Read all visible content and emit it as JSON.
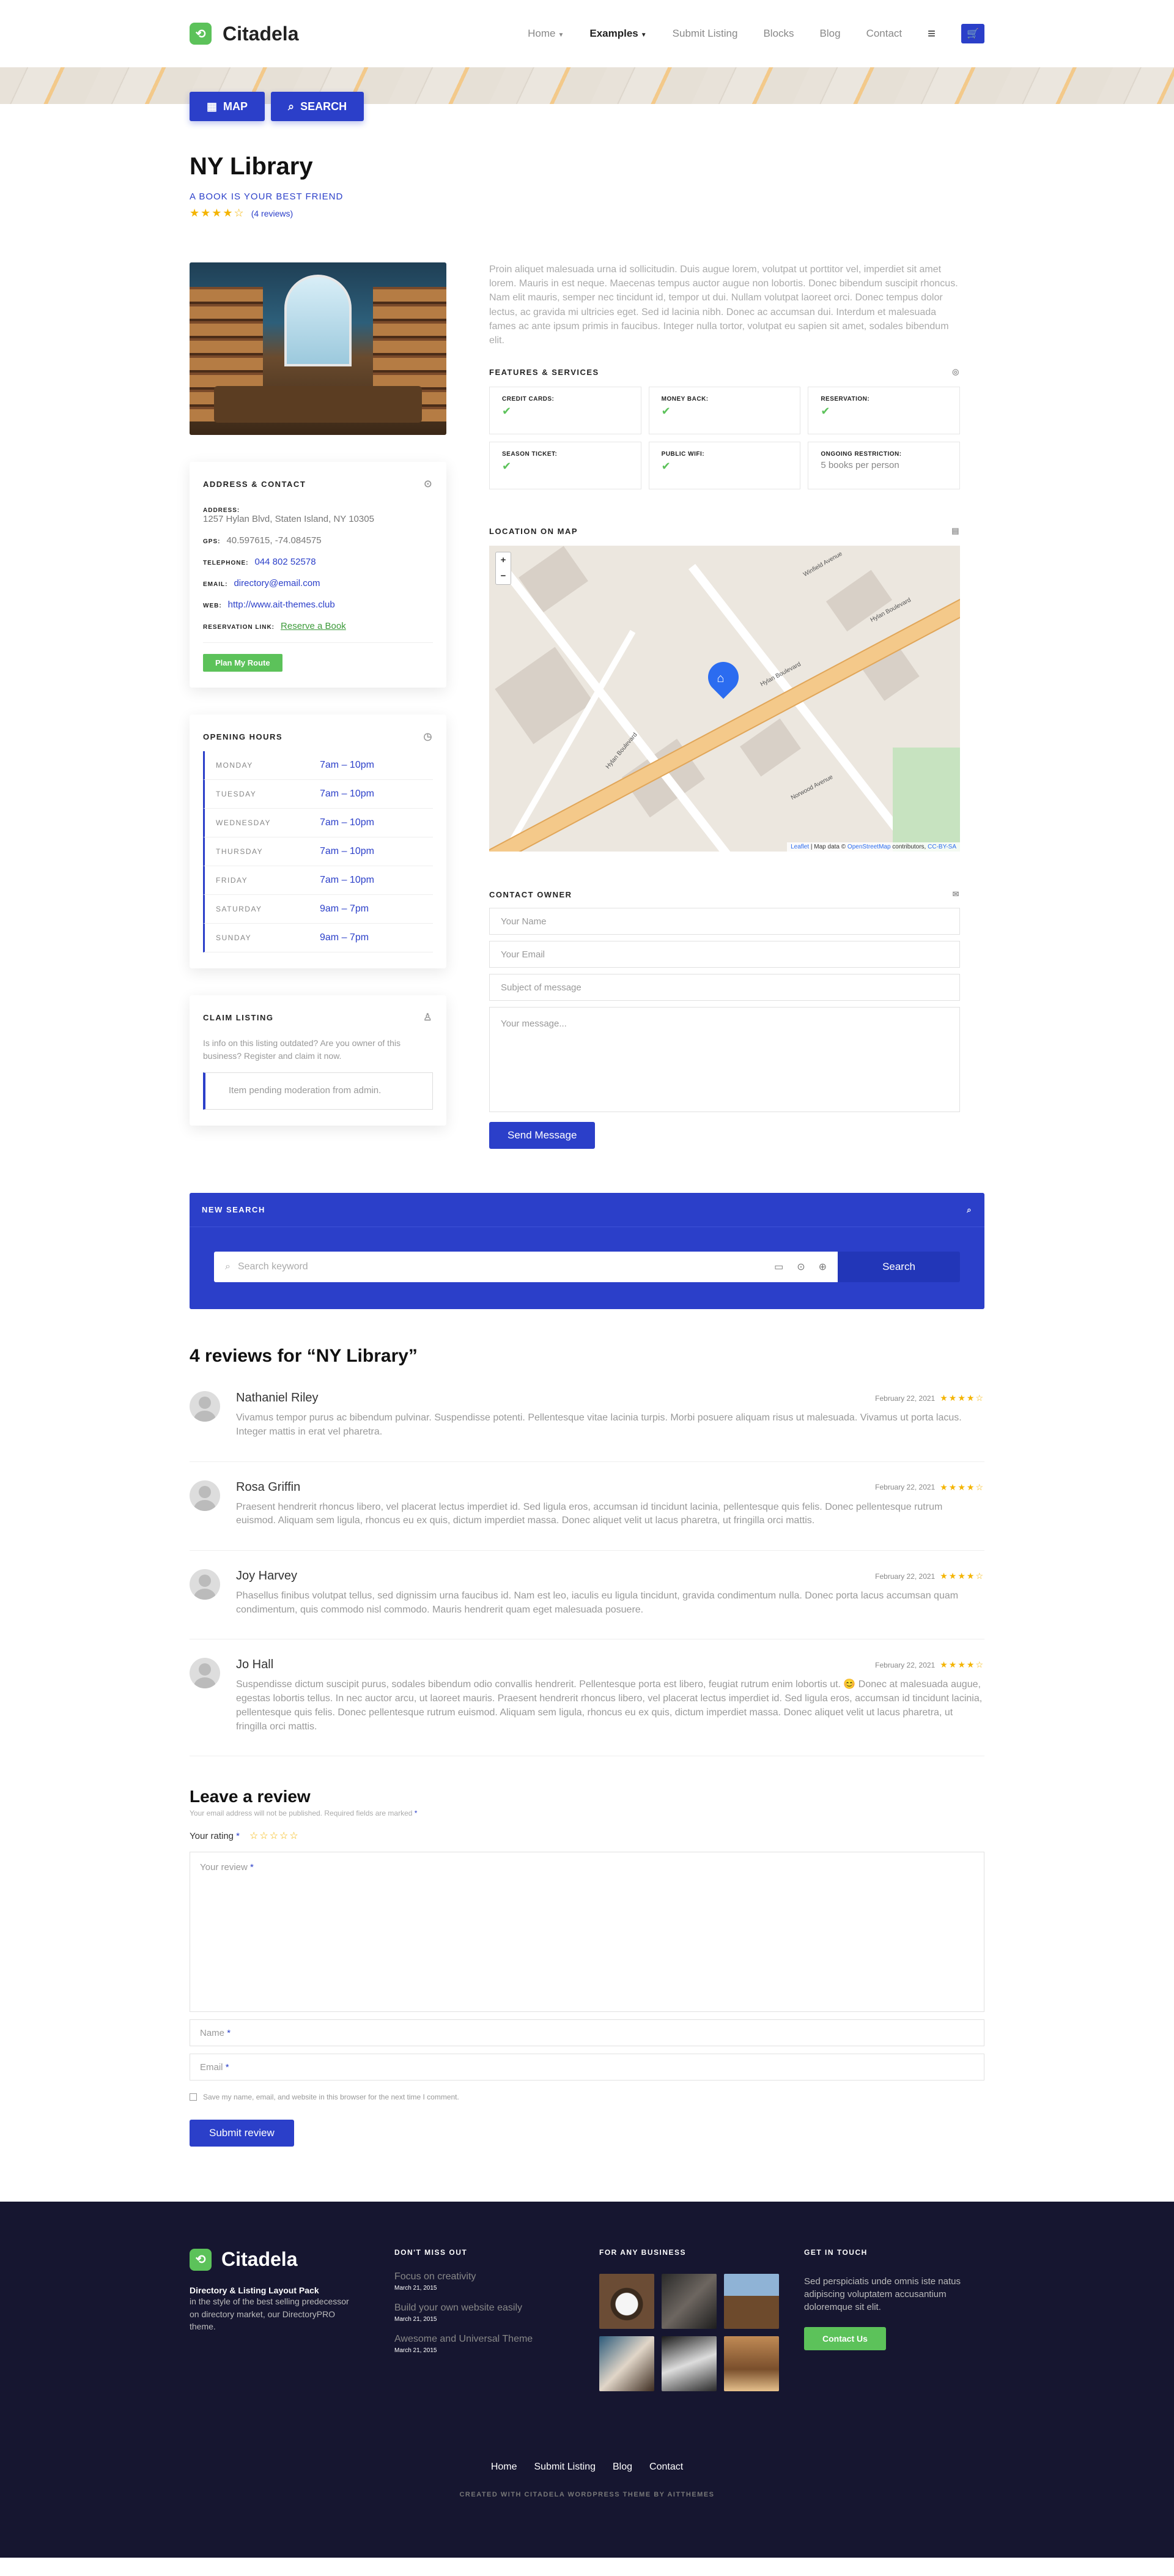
{
  "header": {
    "logo": "Citadela",
    "nav": [
      "Home",
      "Examples",
      "Submit Listing",
      "Blocks",
      "Blog",
      "Contact"
    ]
  },
  "actions": {
    "map": "MAP",
    "search": "SEARCH"
  },
  "listing": {
    "title": "NY Library",
    "subtitle": "A BOOK IS YOUR BEST FRIEND",
    "rating": 4,
    "reviews_count": "(4 reviews)",
    "description": "Proin aliquet malesuada urna id sollicitudin. Duis augue lorem, volutpat ut porttitor vel, imperdiet sit amet lorem. Mauris in est neque. Maecenas tempus auctor augue non lobortis. Donec bibendum suscipit rhoncus. Nam elit mauris, semper nec tincidunt id, tempor ut dui. Nullam volutpat laoreet orci. Donec tempus dolor lectus, ac gravida mi ultricies eget. Sed id lacinia nibh. Donec ac accumsan dui. Interdum et malesuada fames ac ante ipsum primis in faucibus. Integer nulla tortor, volutpat eu sapien sit amet, sodales bibendum elit."
  },
  "address": {
    "heading": "ADDRESS & CONTACT",
    "address_label": "ADDRESS:",
    "address": "1257 Hylan Blvd, Staten Island, NY 10305",
    "gps_label": "GPS:",
    "gps": "40.597615, -74.084575",
    "telephone_label": "TELEPHONE:",
    "telephone": "044 802 52578",
    "email_label": "EMAIL:",
    "email": "directory@email.com",
    "web_label": "WEB:",
    "web": "http://www.ait-themes.club",
    "reservation_label": "RESERVATION LINK:",
    "reservation": "Reserve a Book",
    "route_button": "Plan My Route"
  },
  "hours": {
    "heading": "OPENING HOURS",
    "rows": [
      {
        "day": "MONDAY",
        "time": "7am – 10pm"
      },
      {
        "day": "TUESDAY",
        "time": "7am – 10pm"
      },
      {
        "day": "WEDNESDAY",
        "time": "7am – 10pm"
      },
      {
        "day": "THURSDAY",
        "time": "7am – 10pm"
      },
      {
        "day": "FRIDAY",
        "time": "7am – 10pm"
      },
      {
        "day": "SATURDAY",
        "time": "9am – 7pm"
      },
      {
        "day": "SUNDAY",
        "time": "9am – 7pm"
      }
    ]
  },
  "claim": {
    "heading": "CLAIM LISTING",
    "text": "Is info on this listing outdated? Are you owner of this business? Register and claim it now.",
    "notice": "Item pending moderation from admin."
  },
  "features": {
    "heading": "FEATURES & SERVICES",
    "items": [
      {
        "label": "CREDIT CARDS:",
        "value": "✔"
      },
      {
        "label": "MONEY BACK:",
        "value": "✔"
      },
      {
        "label": "RESERVATION:",
        "value": "✔"
      },
      {
        "label": "SEASON TICKET:",
        "value": "✔"
      },
      {
        "label": "PUBLIC WIFI:",
        "value": "✔"
      },
      {
        "label": "ONGOING RESTRICTION:",
        "value": "5 books per person"
      }
    ]
  },
  "map": {
    "heading": "LOCATION ON MAP",
    "streets": [
      "Hylan Boulevard",
      "Hylan Boulevard",
      "Winfield Avenue",
      "Norwood Avenue",
      "Hylan Boulevard"
    ],
    "attribution_a": "Leaflet",
    "attribution_b": " | Map data © ",
    "attribution_c": "OpenStreetMap",
    "attribution_d": " contributors, ",
    "attribution_e": "CC-BY-SA"
  },
  "contact_form": {
    "heading": "CONTACT OWNER",
    "name": "Your Name",
    "email": "Your Email",
    "subject": "Subject of message",
    "message": "Your message...",
    "send": "Send Message"
  },
  "new_search": {
    "heading": "NEW SEARCH",
    "placeholder": "Search keyword",
    "button": "Search"
  },
  "reviews": {
    "title": "4 reviews for “NY Library”",
    "items": [
      {
        "name": "Nathaniel Riley",
        "date": "February 22, 2021",
        "rating": "★★★★☆",
        "text": "Vivamus tempor purus ac bibendum pulvinar. Suspendisse potenti. Pellentesque vitae lacinia turpis. Morbi posuere aliquam risus ut malesuada. Vivamus ut porta lacus. Integer mattis in erat vel pharetra."
      },
      {
        "name": "Rosa Griffin",
        "date": "February 22, 2021",
        "rating": "★★★★☆",
        "text": "Praesent hendrerit rhoncus libero, vel placerat lectus imperdiet id. Sed ligula eros, accumsan id tincidunt lacinia, pellentesque quis felis. Donec pellentesque rutrum euismod. Aliquam sem ligula, rhoncus eu ex quis, dictum imperdiet massa. Donec aliquet velit ut lacus pharetra, ut fringilla orci mattis."
      },
      {
        "name": "Joy Harvey",
        "date": "February 22, 2021",
        "rating": "★★★★☆",
        "text": "Phasellus finibus volutpat tellus, sed dignissim urna faucibus id. Nam est leo, iaculis eu ligula tincidunt, gravida condimentum nulla. Donec porta lacus accumsan quam condimentum, quis commodo nisl commodo. Mauris hendrerit quam eget malesuada posuere."
      },
      {
        "name": "Jo Hall",
        "date": "February 22, 2021",
        "rating": "★★★★☆",
        "text": "Suspendisse dictum suscipit purus, sodales bibendum odio convallis hendrerit. Pellentesque porta est libero, feugiat rutrum enim lobortis ut. 😊 Donec at malesuada augue, egestas lobortis tellus. In nec auctor arcu, ut laoreet mauris. Praesent hendrerit rhoncus libero, vel placerat lectus imperdiet id. Sed ligula eros, accumsan id tincidunt lacinia, pellentesque quis felis. Donec pellentesque rutrum euismod. Aliquam sem ligula, rhoncus eu ex quis, dictum imperdiet massa. Donec aliquet velit ut lacus pharetra, ut fringilla orci mattis."
      }
    ]
  },
  "leave_review": {
    "title": "Leave a review",
    "note": "Your email address will not be published. Required fields are marked",
    "rating_label": "Your rating",
    "empty_stars": "☆☆☆☆☆",
    "review_placeholder": "Your review",
    "name_placeholder": "Name",
    "email_placeholder": "Email",
    "save_label": "Save my name, email, and website in this browser for the next time I comment.",
    "submit": "Submit review"
  },
  "footer": {
    "logo": "Citadela",
    "tagline": "Directory & Listing Layout Pack",
    "description": "in the style of the best selling predecessor on directory market, our DirectoryPRO theme.",
    "col2_heading": "DON'T MISS OUT",
    "posts": [
      {
        "title": "Focus on creativity",
        "date": "March 21, 2015"
      },
      {
        "title": "Build your own website easily",
        "date": "March 21, 2015"
      },
      {
        "title": "Awesome and Universal Theme",
        "date": "March 21, 2015"
      }
    ],
    "col3_heading": "FOR ANY BUSINESS",
    "col4_heading": "GET IN TOUCH",
    "contact_text": "Sed perspiciatis unde omnis iste natus adipiscing voluptatem accusantium doloremque sit elit.",
    "contact_button": "Contact Us",
    "nav": [
      "Home",
      "Submit Listing",
      "Blog",
      "Contact"
    ],
    "credit": "CREATED WITH CITADELA WORDPRESS THEME BY AITTHEMES"
  },
  "colors": {
    "primary": "#2b3fc9",
    "accent_green": "#5cc25a",
    "footer_bg": "#161630",
    "star": "#f4b400"
  }
}
